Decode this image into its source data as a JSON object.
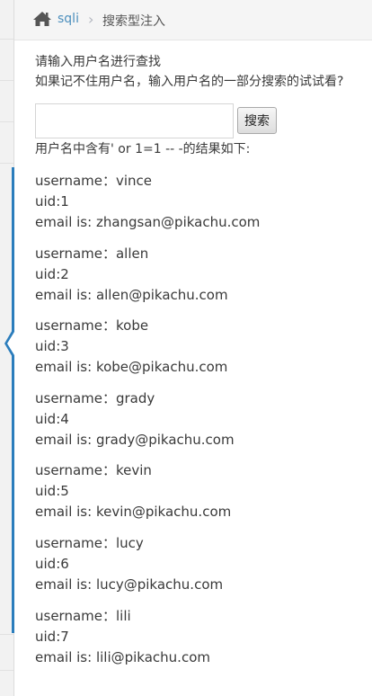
{
  "breadcrumb": {
    "home_icon": "home-icon",
    "link": "sqli",
    "separator_icon": "chevron-right-icon",
    "current": "搜索型注入"
  },
  "prompt": {
    "line1": "请输入用户名进行查找",
    "line2": "如果记不住用户名，输入用户名的一部分搜索的试试看?"
  },
  "search": {
    "value": "",
    "button_label": "搜索"
  },
  "result_caption": "用户名中含有' or 1=1 -- -的结果如下:",
  "results": [
    {
      "username": "username：vince",
      "uid": "uid:1",
      "email": "email is: zhangsan@pikachu.com"
    },
    {
      "username": "username：allen",
      "uid": "uid:2",
      "email": "email is: allen@pikachu.com"
    },
    {
      "username": "username：kobe",
      "uid": "uid:3",
      "email": "email is: kobe@pikachu.com"
    },
    {
      "username": "username：grady",
      "uid": "uid:4",
      "email": "email is: grady@pikachu.com"
    },
    {
      "username": "username：kevin",
      "uid": "uid:5",
      "email": "email is: kevin@pikachu.com"
    },
    {
      "username": "username：lucy",
      "uid": "uid:6",
      "email": "email is: lucy@pikachu.com"
    },
    {
      "username": "username：lili",
      "uid": "uid:7",
      "email": "email is: lili@pikachu.com"
    }
  ],
  "colors": {
    "accent": "#2b7dbc",
    "link": "#4c8fbd",
    "text": "#393939"
  }
}
